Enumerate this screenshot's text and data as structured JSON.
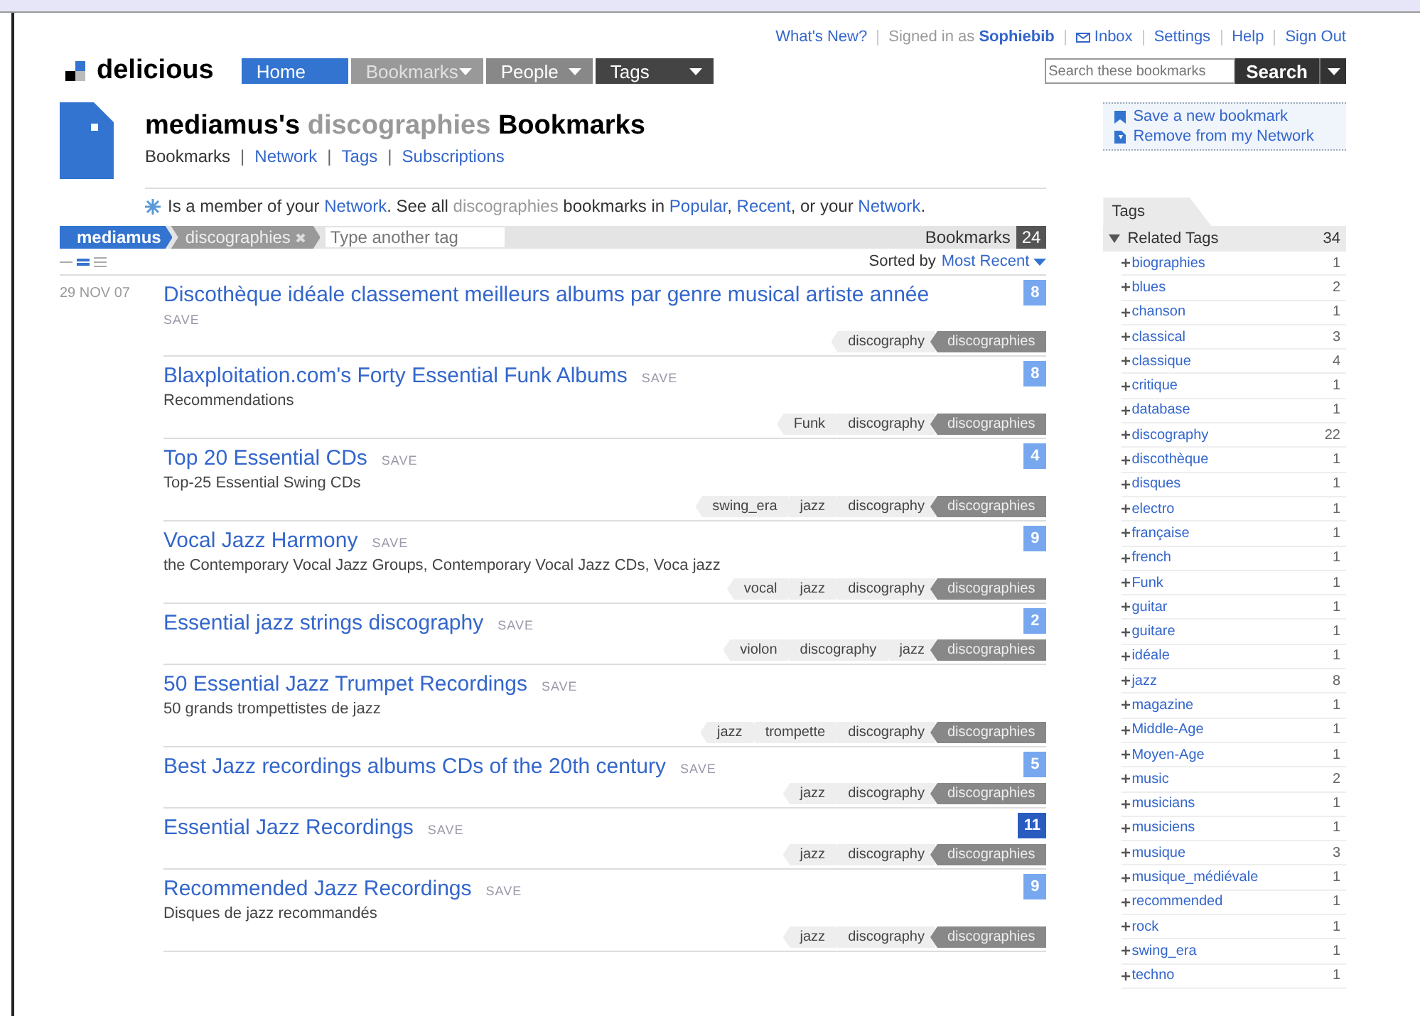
{
  "top_links": {
    "whats_new": "What's New?",
    "signed_in": "Signed in as",
    "user": "Sophiebib",
    "inbox": "Inbox",
    "settings": "Settings",
    "help": "Help",
    "sign_out": "Sign Out"
  },
  "logo": "delicious",
  "nav": [
    {
      "label": "Home",
      "selected": true,
      "dropdown": false
    },
    {
      "label": "Bookmarks",
      "selected": false,
      "dropdown": true
    },
    {
      "label": "People",
      "selected": false,
      "dropdown": true
    },
    {
      "label": "Tags",
      "selected": false,
      "dropdown": true
    }
  ],
  "search": {
    "placeholder": "Search these bookmarks",
    "button": "Search"
  },
  "heading": {
    "owner": "mediamus's",
    "tag": "discographies",
    "suffix": "Bookmarks"
  },
  "subnav": [
    {
      "label": "Bookmarks",
      "selected": true
    },
    {
      "label": "Network",
      "selected": false
    },
    {
      "label": "Tags",
      "selected": false
    },
    {
      "label": "Subscriptions",
      "selected": false
    }
  ],
  "member_note": [
    {
      "kind": "text",
      "text": "Is a member of your"
    },
    {
      "kind": "link",
      "text": "Network"
    },
    {
      "kind": "text",
      "text": ".  See all"
    },
    {
      "kind": "tag",
      "text": "discographies"
    },
    {
      "kind": "text",
      "text": "bookmarks in"
    },
    {
      "kind": "link",
      "text": "Popular"
    },
    {
      "kind": "text",
      "text": ","
    },
    {
      "kind": "link",
      "text": "Recent"
    },
    {
      "kind": "text",
      "text": ", or your"
    },
    {
      "kind": "link",
      "text": "Network"
    },
    {
      "kind": "text",
      "text": "."
    }
  ],
  "subnav_separator": "|",
  "actions": [
    {
      "label": "Save a new bookmark"
    },
    {
      "label": "Remove from my Network"
    }
  ],
  "tag_filter": {
    "user": "mediamus",
    "tag": "discographies",
    "placeholder": "Type another tag",
    "count_label": "Bookmarks",
    "count": "24"
  },
  "view_modes": [
    {
      "selected": false
    },
    {
      "selected": true
    },
    {
      "selected": false
    }
  ],
  "sort": {
    "label": "Sorted by",
    "value": "Most Recent"
  },
  "bookmarks": [
    {
      "date": "29 NOV 07",
      "title": "Discothèque idéale classement meilleurs albums par genre musical artiste année",
      "save": "SAVE",
      "save_below": true,
      "count": "8",
      "highlighted": false,
      "tags": [
        {
          "label": "discography",
          "current": false
        },
        {
          "label": "discographies",
          "current": true
        }
      ]
    },
    {
      "title": "Blaxploitation.com's Forty Essential Funk Albums",
      "save": "SAVE",
      "save_below": false,
      "note": "Recommendations",
      "count": "8",
      "highlighted": false,
      "tags": [
        {
          "label": "Funk",
          "current": false
        },
        {
          "label": "discography",
          "current": false
        },
        {
          "label": "discographies",
          "current": true
        }
      ]
    },
    {
      "title": "Top 20 Essential CDs",
      "save": "SAVE",
      "save_below": false,
      "note": "Top-25 Essential Swing CDs",
      "count": "4",
      "highlighted": false,
      "tags": [
        {
          "label": "swing_era",
          "current": false
        },
        {
          "label": "jazz",
          "current": false
        },
        {
          "label": "discography",
          "current": false
        },
        {
          "label": "discographies",
          "current": true
        }
      ]
    },
    {
      "title": "Vocal Jazz Harmony",
      "save": "SAVE",
      "save_below": false,
      "note": "the Contemporary Vocal Jazz Groups, Contemporary Vocal Jazz CDs, Voca jazz",
      "count": "9",
      "highlighted": false,
      "tags": [
        {
          "label": "vocal",
          "current": false
        },
        {
          "label": "jazz",
          "current": false
        },
        {
          "label": "discography",
          "current": false
        },
        {
          "label": "discographies",
          "current": true
        }
      ]
    },
    {
      "title": "Essential jazz strings discography",
      "save": "SAVE",
      "save_below": false,
      "count": "2",
      "highlighted": false,
      "tags": [
        {
          "label": "violon",
          "current": false
        },
        {
          "label": "discography",
          "current": false
        },
        {
          "label": "jazz",
          "current": false
        },
        {
          "label": "discographies",
          "current": true
        }
      ]
    },
    {
      "title": "50 Essential Jazz Trumpet Recordings",
      "save": "SAVE",
      "save_below": false,
      "note": "50 grands trompettistes de jazz",
      "tags": [
        {
          "label": "jazz",
          "current": false
        },
        {
          "label": "trompette",
          "current": false
        },
        {
          "label": "discography",
          "current": false
        },
        {
          "label": "discographies",
          "current": true
        }
      ]
    },
    {
      "title": "Best Jazz recordings albums CDs of the 20th century",
      "save": "SAVE",
      "save_below": false,
      "count": "5",
      "highlighted": false,
      "tags": [
        {
          "label": "jazz",
          "current": false
        },
        {
          "label": "discography",
          "current": false
        },
        {
          "label": "discographies",
          "current": true
        }
      ]
    },
    {
      "title": "Essential Jazz Recordings",
      "save": "SAVE",
      "save_below": false,
      "count": "11",
      "highlighted": true,
      "tags": [
        {
          "label": "jazz",
          "current": false
        },
        {
          "label": "discography",
          "current": false
        },
        {
          "label": "discographies",
          "current": true
        }
      ]
    },
    {
      "title": "Recommended Jazz Recordings",
      "save": "SAVE",
      "save_below": false,
      "note": "Disques de jazz recommandés",
      "count": "9",
      "highlighted": false,
      "tags": [
        {
          "label": "jazz",
          "current": false
        },
        {
          "label": "discography",
          "current": false
        },
        {
          "label": "discographies",
          "current": true
        }
      ]
    }
  ],
  "sidebar": {
    "tab": "Tags",
    "section": {
      "label": "Related Tags",
      "count": "34",
      "expanded": true
    },
    "tags": [
      {
        "label": "biographies",
        "count": "1"
      },
      {
        "label": "blues",
        "count": "2"
      },
      {
        "label": "chanson",
        "count": "1"
      },
      {
        "label": "classical",
        "count": "3"
      },
      {
        "label": "classique",
        "count": "4"
      },
      {
        "label": "critique",
        "count": "1"
      },
      {
        "label": "database",
        "count": "1"
      },
      {
        "label": "discography",
        "count": "22"
      },
      {
        "label": "discothèque",
        "count": "1"
      },
      {
        "label": "disques",
        "count": "1"
      },
      {
        "label": "electro",
        "count": "1"
      },
      {
        "label": "française",
        "count": "1"
      },
      {
        "label": "french",
        "count": "1"
      },
      {
        "label": "Funk",
        "count": "1"
      },
      {
        "label": "guitar",
        "count": "1"
      },
      {
        "label": "guitare",
        "count": "1"
      },
      {
        "label": "idéale",
        "count": "1"
      },
      {
        "label": "jazz",
        "count": "8"
      },
      {
        "label": "magazine",
        "count": "1"
      },
      {
        "label": "Middle-Age",
        "count": "1"
      },
      {
        "label": "Moyen-Age",
        "count": "1"
      },
      {
        "label": "music",
        "count": "2"
      },
      {
        "label": "musicians",
        "count": "1"
      },
      {
        "label": "musiciens",
        "count": "1"
      },
      {
        "label": "musique",
        "count": "3"
      },
      {
        "label": "musique_médiévale",
        "count": "1"
      },
      {
        "label": "recommended",
        "count": "1"
      },
      {
        "label": "rock",
        "count": "1"
      },
      {
        "label": "swing_era",
        "count": "1"
      },
      {
        "label": "techno",
        "count": "1"
      }
    ]
  }
}
